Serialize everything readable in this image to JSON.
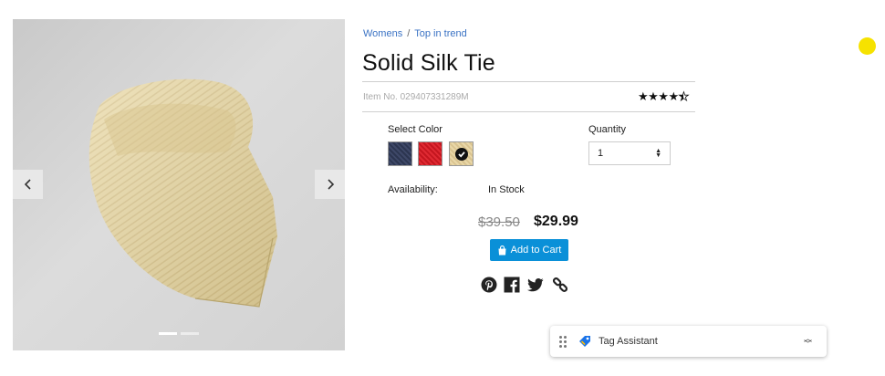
{
  "gallery": {
    "prev_icon": "chevron-left-icon",
    "next_icon": "chevron-right-icon",
    "slide_count": 2,
    "active_slide": 1
  },
  "breadcrumb": {
    "items": [
      "Womens",
      "Top in trend"
    ],
    "separator": "/"
  },
  "product": {
    "title": "Solid Silk Tie",
    "item_no": "Item No. 029407331289M",
    "rating": 4.5,
    "stars": "★★★★"
  },
  "options": {
    "color_label": "Select Color",
    "colors": [
      {
        "name": "navy",
        "hex": "#2c3550"
      },
      {
        "name": "red",
        "hex": "#d01f28"
      },
      {
        "name": "gold",
        "hex": "#e2cd9a",
        "selected": true
      }
    ],
    "quantity_label": "Quantity",
    "quantity_value": "1"
  },
  "availability": {
    "label": "Availability:",
    "value": "In Stock"
  },
  "pricing": {
    "old_price": "$39.50",
    "new_price": "$29.99"
  },
  "cart": {
    "label": "Add to Cart",
    "icon": "shopping-bag-icon",
    "color": "#0a90d8"
  },
  "share": {
    "icons": [
      "pinterest-icon",
      "facebook-icon",
      "twitter-icon",
      "link-icon"
    ]
  },
  "tag_assistant": {
    "label": "Tag Assistant",
    "icon": "tag-assistant-icon"
  },
  "colors": {
    "accent": "#0a90d8",
    "link": "#3b73c4",
    "indicator": "#f6e200"
  }
}
